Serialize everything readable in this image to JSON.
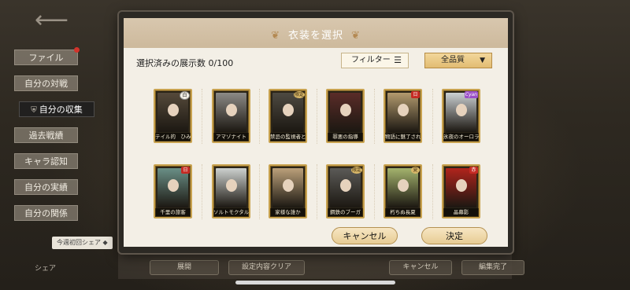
{
  "background": {
    "side_menu": [
      {
        "label": "ファイル",
        "notify": true
      },
      {
        "label": "自分の対戦",
        "notify": false
      },
      {
        "label": "自分の収集",
        "notify": false,
        "active": true
      },
      {
        "label": "過去戦績",
        "notify": false
      },
      {
        "label": "キャラ認知",
        "notify": false
      },
      {
        "label": "自分の実績",
        "notify": false
      },
      {
        "label": "自分の関係",
        "notify": false
      }
    ],
    "share_tag": "今週初回シェア ◆",
    "share_label": "シェア",
    "bottom_buttons": [
      "展開",
      "設定内容クリア",
      "キャンセル",
      "編集完了"
    ]
  },
  "modal": {
    "title": "衣装を選択",
    "count_label": "選択済みの展示数 0/100",
    "filter_label": "フィルター",
    "quality_label": "全品質",
    "cancel_label": "キャンセル",
    "ok_label": "決定",
    "costumes": [
      {
        "name": "テイル的　ひみつの",
        "badge": "白",
        "badge_style": "white",
        "tone": "#55493a"
      },
      {
        "name": "アマゾナイト",
        "badge": "",
        "badge_style": "",
        "tone": "#8c8a86"
      },
      {
        "name": "禁忌の監視者と影の薬",
        "badge": "限定",
        "badge_style": "gold",
        "tone": "#4e4a41"
      },
      {
        "name": "罪悪の指導",
        "badge": "",
        "badge_style": "",
        "tone": "#5a2c28"
      },
      {
        "name": "物語に魅了された少女",
        "badge": "日",
        "badge_style": "red",
        "tone": "#b39a6e"
      },
      {
        "name": "氷夜のオーロラ",
        "badge": "Cyan",
        "badge_style": "purple",
        "tone": "#cbd0d3"
      },
      {
        "name": "千里の旅客",
        "badge": "日",
        "badge_style": "red",
        "tone": "#6a8f86"
      },
      {
        "name": "ソルトモクタル",
        "badge": "",
        "badge_style": "",
        "tone": "#cdd1cf"
      },
      {
        "name": "家様な誰か",
        "badge": "",
        "badge_style": "",
        "tone": "#bba07a"
      },
      {
        "name": "鋼鉄のブーガ",
        "badge": "限定",
        "badge_style": "gold",
        "tone": "#5b5a57"
      },
      {
        "name": "朽ちぬ長夏",
        "badge": "夏",
        "badge_style": "gold",
        "tone": "#a4b36d"
      },
      {
        "name": "晶幕影",
        "badge": "赤",
        "badge_style": "red",
        "tone": "#b0241c"
      }
    ]
  },
  "colors": {
    "panel": "#f3efe6",
    "title_bar": "#d8c7ae",
    "gold_frame": "#c8a24f"
  }
}
